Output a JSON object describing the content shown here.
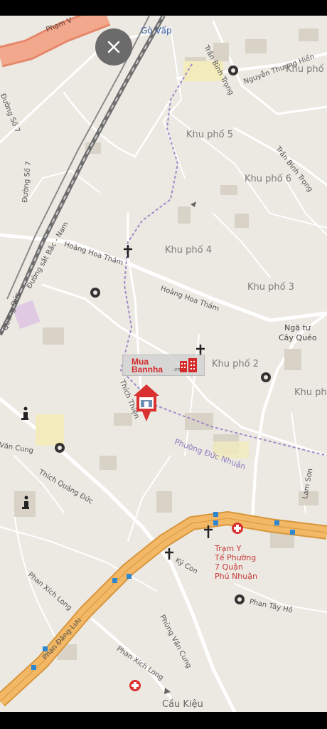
{
  "map": {
    "areas": {
      "go_vap": "Gò Vấp",
      "khu_pho_5": "Khu phố 5",
      "khu_pho_6": "Khu phố 6",
      "khu_pho_4": "Khu phố 4",
      "khu_pho_3": "Khu phố 3",
      "khu_pho_2": "Khu phố 2",
      "khu_pho_top_right": "Khu phố",
      "khu_pho_right": "Khu phố",
      "nga_tu_line1": "Ngã tư",
      "nga_tu_line2": "Cây Quéo",
      "phuong": "Phường Đức Nhuận"
    },
    "streets": {
      "pham": "Phạm V",
      "tran_binh_trong_1": "Trần Bình Trọng",
      "nguyen_thuong_hien": "Nguyễn Thượng Hiền",
      "tran_binh_trong_2": "Trần Bình Trọng",
      "duong_so_7_a": "Đường Số 7",
      "duong_so_7_b": "Đường Số 7",
      "duong_sat": "Đường sắt Bắc - Nam",
      "hoang_hoa_tham_1": "Hoàng Hoa Thám",
      "hoang_hoa_tham_2": "Hoàng Hoa Thám",
      "quang_duc": "Quang Đức",
      "thich_vertical": "Thích Thiện",
      "van_cung": "Văn Cung",
      "thich_quang_duc": "Thích Quảng Đức",
      "lam_son": "Lam Sơn",
      "ky_con": "Ký Con",
      "phan_tay_ho": "Phan Tây Hồ",
      "phan_xich_long_1": "Phan Xích Long",
      "phan_dang_luu": "Phan Đăng Lưu",
      "phung_van_cung": "Phùng Văn Cung",
      "phan_xich_long_2": "Phan Xích Long",
      "cau_kieu": "Cầu Kiệu"
    },
    "hospital_label": "Trạm Y\nTế Phường\n7 Quận\nPhú Nhuận",
    "watermark": {
      "line1": "Mua",
      "line2": "Bannha",
      "suffix": ".vn"
    },
    "colors": {
      "land": "#ece9e2",
      "major_road": "#f2b866",
      "major_road_edge": "#d8963c",
      "highlight_road": "#f19b7c",
      "minor_road": "#ffffff",
      "railway": "#707070",
      "building": "#d9d2c6",
      "marker_red": "#d9312f"
    },
    "icons": [
      "close-icon",
      "church-icon",
      "temple-icon",
      "info-icon",
      "hospital-icon",
      "house-pin-icon",
      "bus-stop-icon"
    ]
  }
}
